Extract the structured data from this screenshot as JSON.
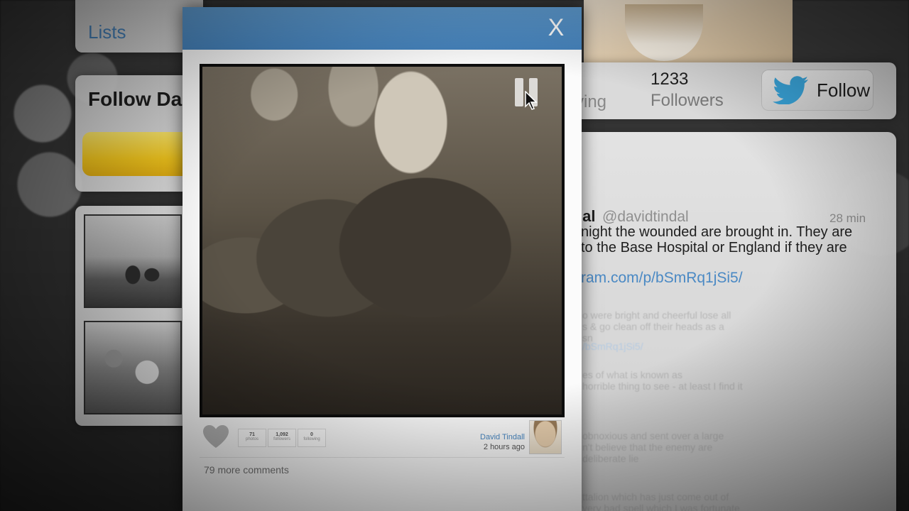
{
  "sidebar": {
    "lists_label": "Lists",
    "follow_title": "Follow Da"
  },
  "profile": {
    "following_fragment": "ving",
    "followers_count": "1233",
    "followers_label": "Followers",
    "follow_button_label": "Follow"
  },
  "tweet": {
    "name_fragment": "lal",
    "handle": "@davidtindal",
    "time": "28 min",
    "lines": [
      "night the wounded are brought in. They are",
      "to the Base Hospital or England if they are"
    ],
    "link": "ram.com/p/bSmRq1jSi5/",
    "faded_lines": [
      "o were bright and cheerful lose all",
      "s & go clean off their heads as a",
      "sn",
      "/bSmRq1jSi5/",
      "es of what is known as",
      "horrible thing to see - at least I find it",
      "obnoxious and sent over a large",
      "n't believe that the enemy are",
      "deliberate lie",
      "ttalion which has just come out of",
      "very bad spell which I was fortunate"
    ]
  },
  "modal": {
    "close_label": "X",
    "stats": [
      {
        "value": "71",
        "label": "photos"
      },
      {
        "value": "1,092",
        "label": "followers"
      },
      {
        "value": "0",
        "label": "following"
      }
    ],
    "author_name": "David Tindall",
    "author_time": "2 hours ago",
    "more_comments": "79 more comments"
  },
  "colors": {
    "header_blue": "#4f8ec7",
    "link_blue": "#4a89c4",
    "twitter_blue": "#3aa6dc",
    "follow_yellow": "#f4c81e"
  }
}
